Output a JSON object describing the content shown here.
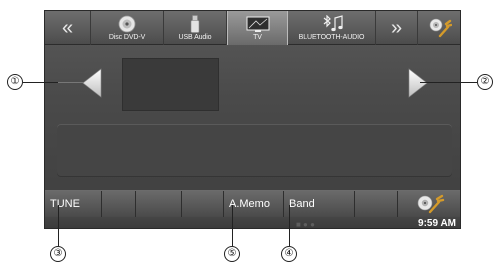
{
  "topbar": {
    "prev_arrow": "«",
    "next_arrow": "»",
    "sources": [
      {
        "label": "Disc DVD-V",
        "icon": "disc-icon"
      },
      {
        "label": "USB Audio",
        "icon": "usb-icon"
      },
      {
        "label": "TV",
        "icon": "tv-icon",
        "active": true
      },
      {
        "label": "BLUETOOTH-AUDIO",
        "icon": "bluetooth-audio-icon"
      }
    ],
    "setup_icon": "setup-icon"
  },
  "main": {
    "left_arrow_icon": "left-arrow-icon",
    "right_arrow_icon": "right-arrow-icon"
  },
  "bottombar": {
    "buttons": [
      "TUNE",
      "",
      "",
      "",
      "A.Memo",
      "Band",
      ""
    ],
    "clock": "9:59 AM",
    "setup_icon": "audio-setup-icon"
  },
  "callouts": [
    "①",
    "②",
    "③",
    "⑤",
    "④"
  ]
}
